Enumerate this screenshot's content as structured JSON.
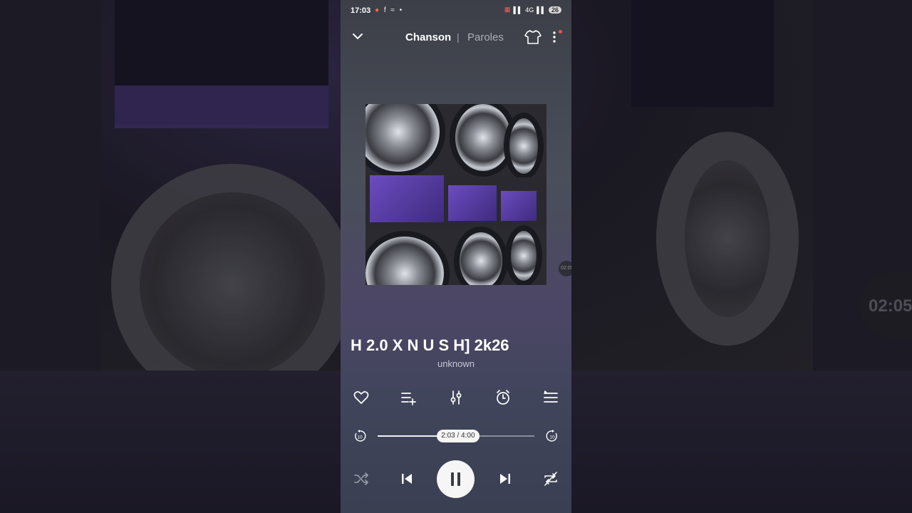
{
  "status_bar": {
    "time": "17:03",
    "notifications": "● f ⚑ •",
    "network": "4G",
    "battery": "26"
  },
  "header": {
    "tab_song": "Chanson",
    "separator": "|",
    "tab_lyrics": "Paroles",
    "icons": [
      "chevron-down-icon",
      "shirt-theme-icon",
      "more-vertical-icon"
    ]
  },
  "track": {
    "title": "H 2.0 X N U S H] 2k26",
    "artist": "unknown"
  },
  "side_time_chip": "02:05",
  "background_time_chip": "02:05",
  "actions": [
    "heart-icon",
    "add-to-playlist-icon",
    "equalizer-icon",
    "timer-icon",
    "queue-icon"
  ],
  "player": {
    "position_text": "2:03 / 4:00",
    "progress_fraction": 0.5125,
    "rewind_label": "10",
    "forward_label": "10"
  },
  "controls": [
    "shuffle-icon",
    "previous-icon",
    "pause-icon",
    "next-icon",
    "repeat-off-icon"
  ],
  "colors": {
    "accent": "#ffffff",
    "notification_dot": "#ff4b4b"
  }
}
